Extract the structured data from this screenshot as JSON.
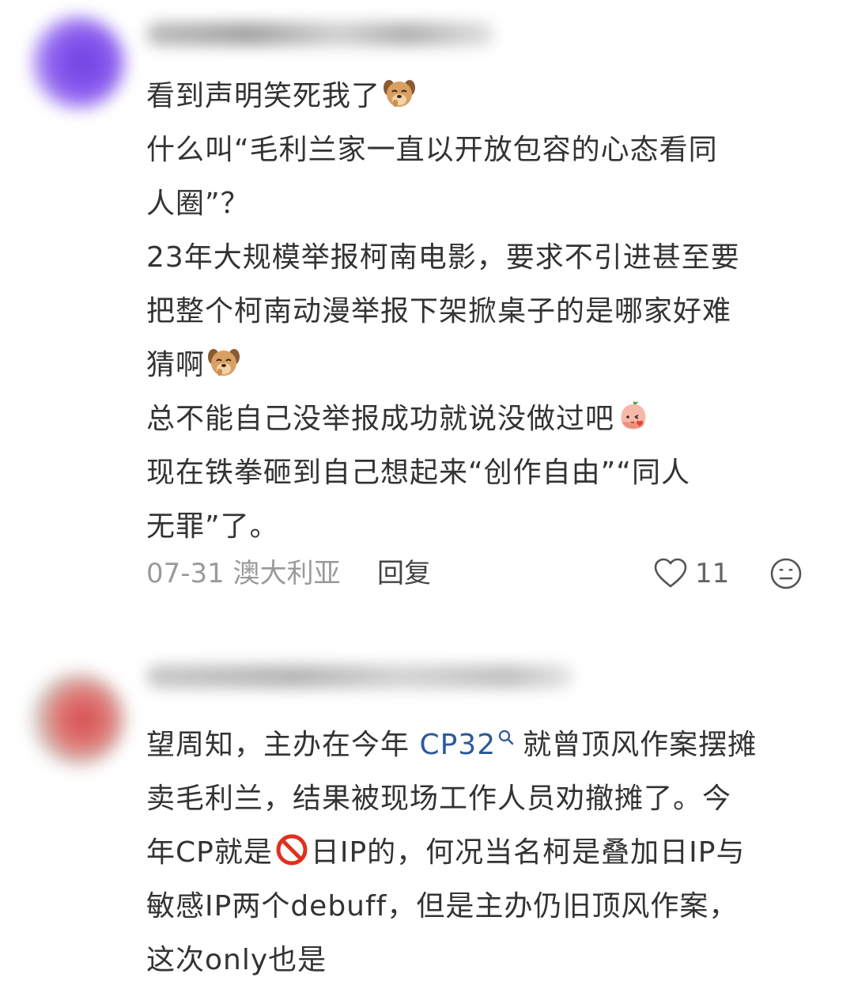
{
  "comments": [
    {
      "avatar_color": "#7b4ae6",
      "lines": {
        "l1": "看到声明笑死我了",
        "l2": "什么叫“毛利兰家一直以开放包容的心态看同",
        "l3": "人圈”？",
        "l4": "23年大规模举报柯南电影，要求不引进甚至要",
        "l5": "把整个柯南动漫举报下架掀桌子的是哪家好难",
        "l6": "猜啊",
        "l7": "总不能自己没举报成功就说没做过吧",
        "l8": "现在铁拳砸到自己想起来“创作自由”“同人",
        "l9": "无罪”了。"
      },
      "date": "07-31",
      "location": "澳大利亚",
      "reply_label": "回复",
      "like_count": "11",
      "icons": [
        "dog-emoji-icon",
        "peach-emoji-icon",
        "heart-icon",
        "smiley-icon"
      ]
    },
    {
      "avatar_color": "#d9534f",
      "lines": {
        "l1_pre": "望周知，主办在今年 ",
        "l1_link": "CP32",
        "l1_post": "就曾顶风作案摆摊",
        "l2": "卖毛利兰，结果被现场工作人员劝撤摊了。今",
        "l3_pre": "年CP就是",
        "l3_post": "日IP的，何况当名柯是叠加日IP与",
        "l4": "敏感IP两个debuff，但是主办仍旧顶风作案，",
        "l5": "这次only也是"
      },
      "icons": [
        "search-icon",
        "prohibited-icon"
      ]
    }
  ]
}
